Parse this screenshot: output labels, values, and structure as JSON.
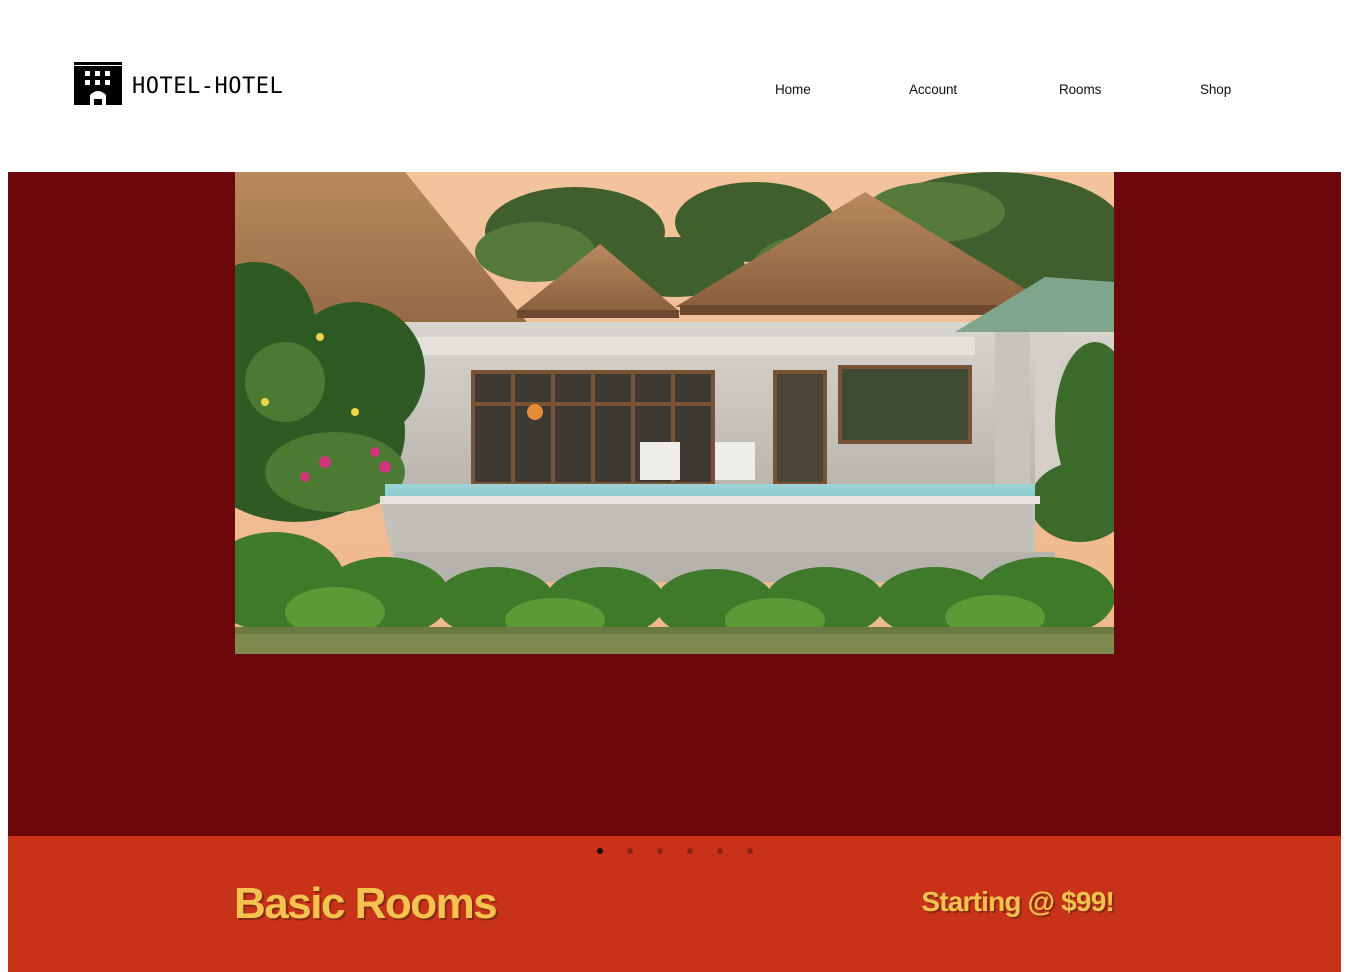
{
  "brand": {
    "name": "HOTEL-HOTEL",
    "icon": "hotel-building-icon"
  },
  "nav": {
    "items": [
      {
        "label": "Home"
      },
      {
        "label": "Account"
      },
      {
        "label": "Rooms"
      },
      {
        "label": "Shop"
      }
    ]
  },
  "carousel": {
    "slide_count": 6,
    "active_index": 0,
    "slide": {
      "title": "Basic Rooms",
      "price_text": "Starting @ $99!"
    }
  },
  "colors": {
    "hero_background": "#6c080b",
    "caption_background": "#c83218",
    "caption_text": "#f4c24e",
    "dot_active": "#1a0a08",
    "dot_inactive": "#8a2412"
  }
}
